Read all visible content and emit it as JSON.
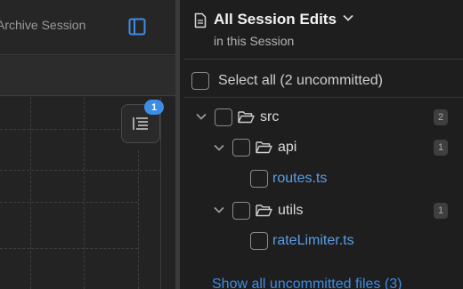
{
  "left": {
    "archive_label": "Archive Session",
    "outline_badge": "1"
  },
  "panel": {
    "title": "All Session Edits",
    "subtitle": "in this Session",
    "select_all_label": "Select all (2 uncommitted)",
    "tree": {
      "src": {
        "label": "src",
        "count": "2"
      },
      "api": {
        "label": "api",
        "count": "1"
      },
      "routes": {
        "label": "routes.ts"
      },
      "utils": {
        "label": "utils",
        "count": "1"
      },
      "rateLimiter": {
        "label": "rateLimiter.ts"
      }
    },
    "show_all_link": "Show all uncommitted files (3)"
  },
  "colors": {
    "accent": "#3d8ce6",
    "file_link": "#5b9ee6",
    "panel_bg": "#1e1e1e"
  },
  "icons": {
    "sidebar_toggle": "sidebar-panel-icon",
    "outline": "list-outline-icon",
    "document": "document-icon",
    "folder": "folder-open-icon",
    "chevron": "chevron-down-icon"
  }
}
